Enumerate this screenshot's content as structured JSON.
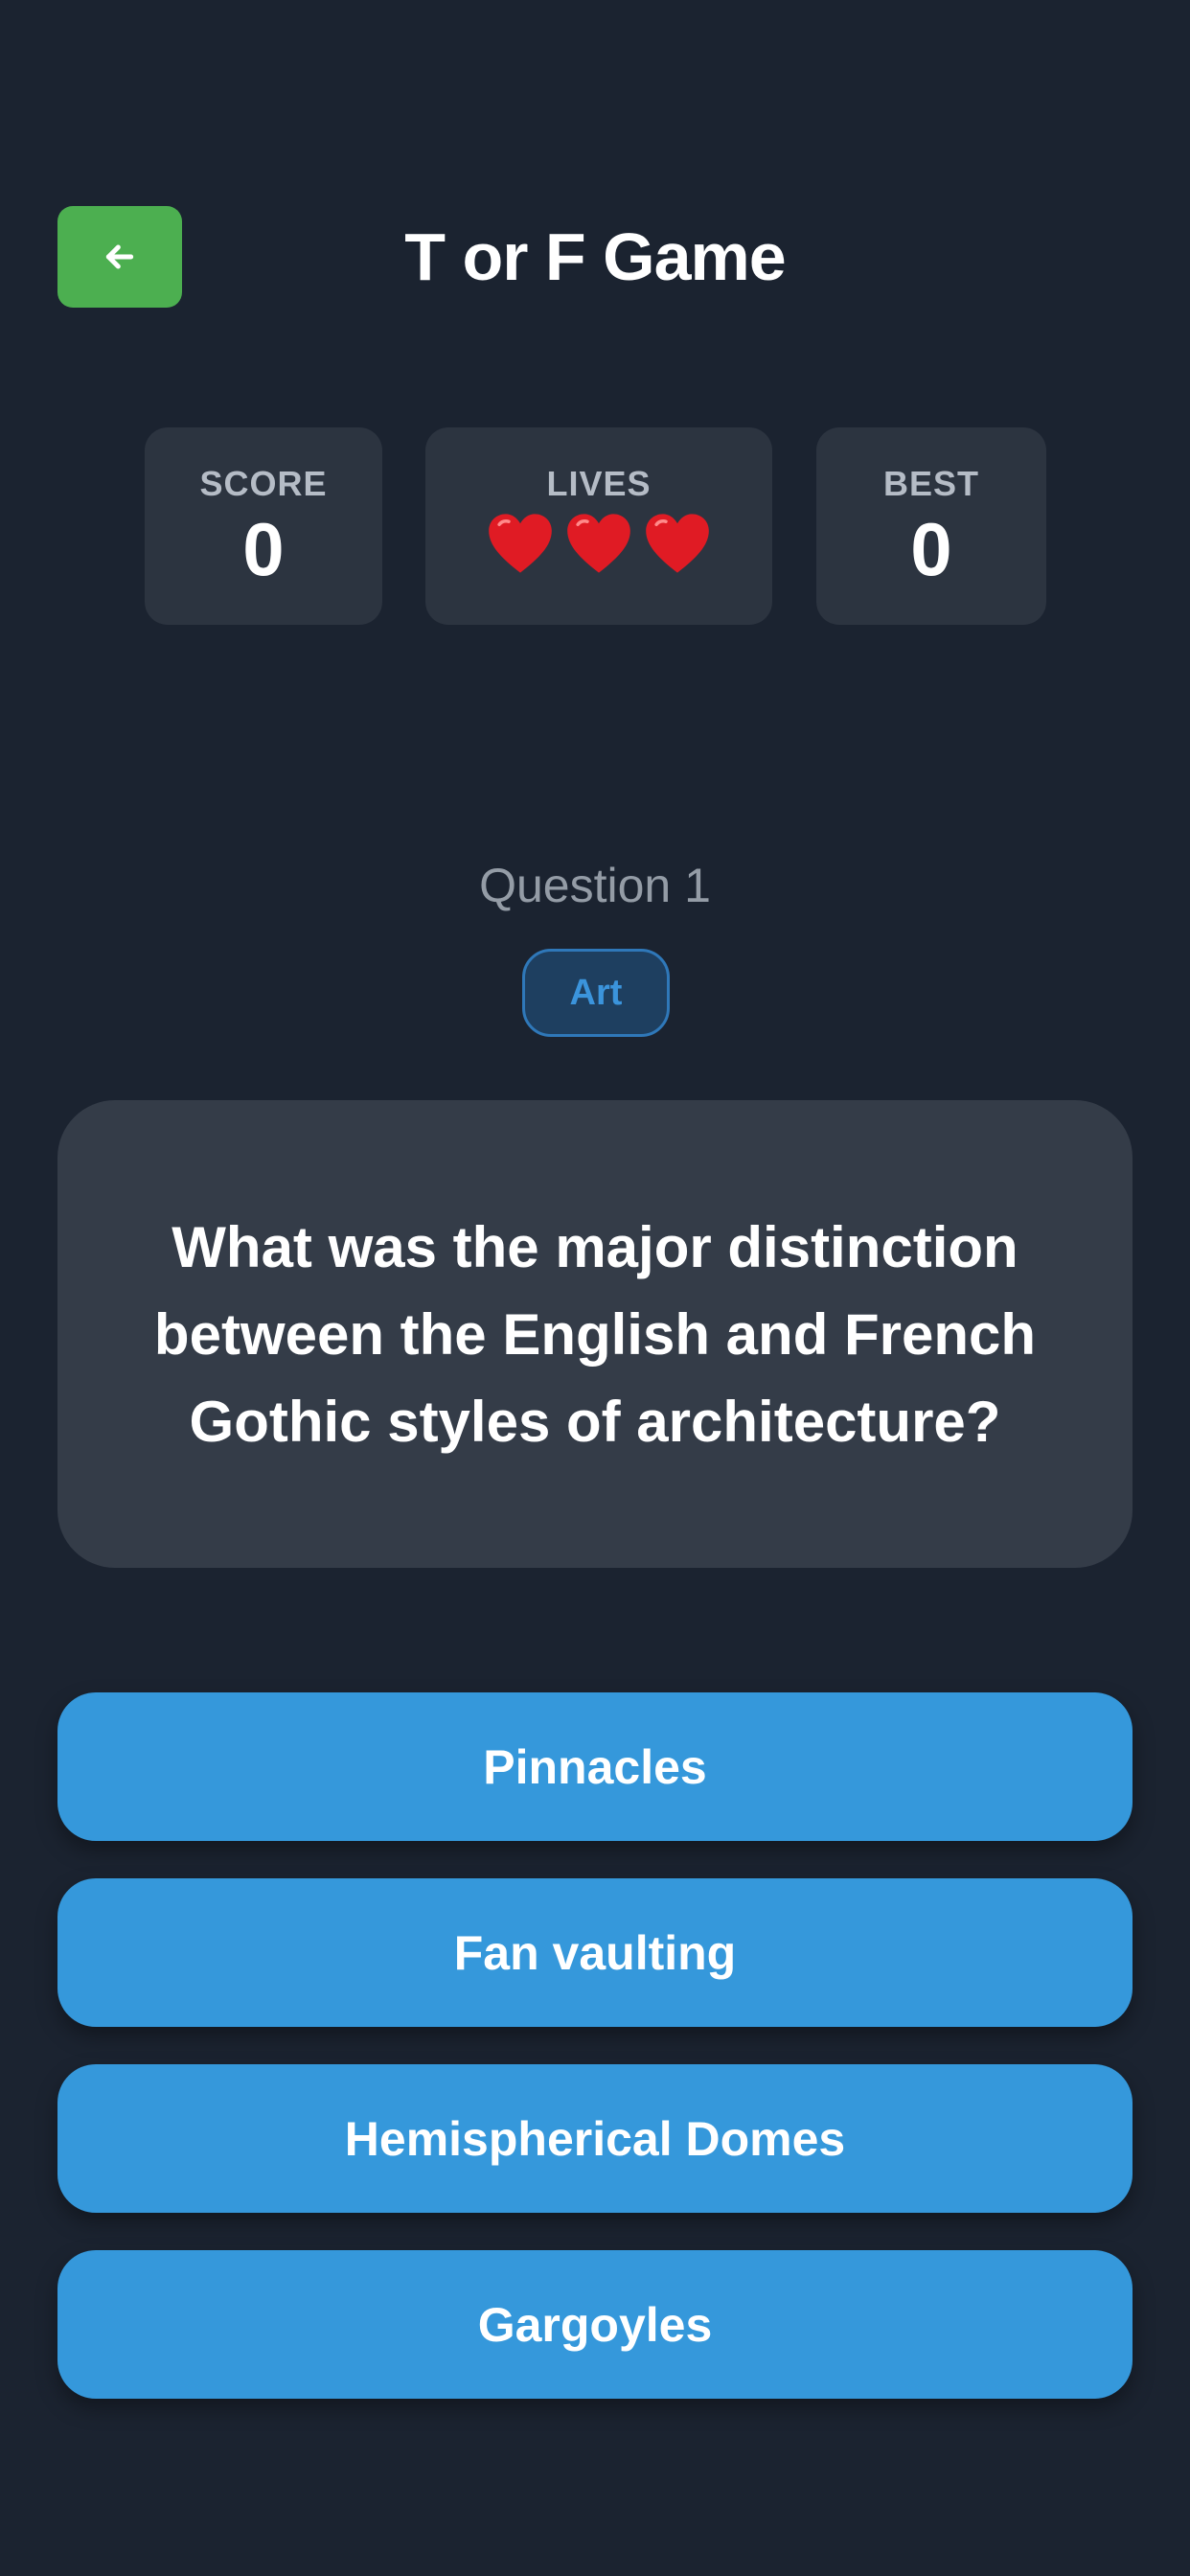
{
  "header": {
    "back_icon": "arrow-left-icon",
    "title": "T or F Game"
  },
  "stats": {
    "score": {
      "label": "SCORE",
      "value": "0"
    },
    "lives": {
      "label": "LIVES",
      "count": 3,
      "icon": "heart-icon"
    },
    "best": {
      "label": "BEST",
      "value": "0"
    }
  },
  "question": {
    "number_label": "Question 1",
    "category": "Art",
    "text": "What was the major distinction between the English and French Gothic styles of architecture?"
  },
  "answers": [
    {
      "label": "Pinnacles"
    },
    {
      "label": "Fan vaulting"
    },
    {
      "label": "Hemispherical Domes"
    },
    {
      "label": "Gargoyles"
    }
  ],
  "colors": {
    "background": "#1b2330",
    "back_button": "#4caf50",
    "card": "#2c3440",
    "question_card": "#343c48",
    "answer_button": "#3598db",
    "category_text": "#3b94dc",
    "heart": "#e01b24"
  }
}
